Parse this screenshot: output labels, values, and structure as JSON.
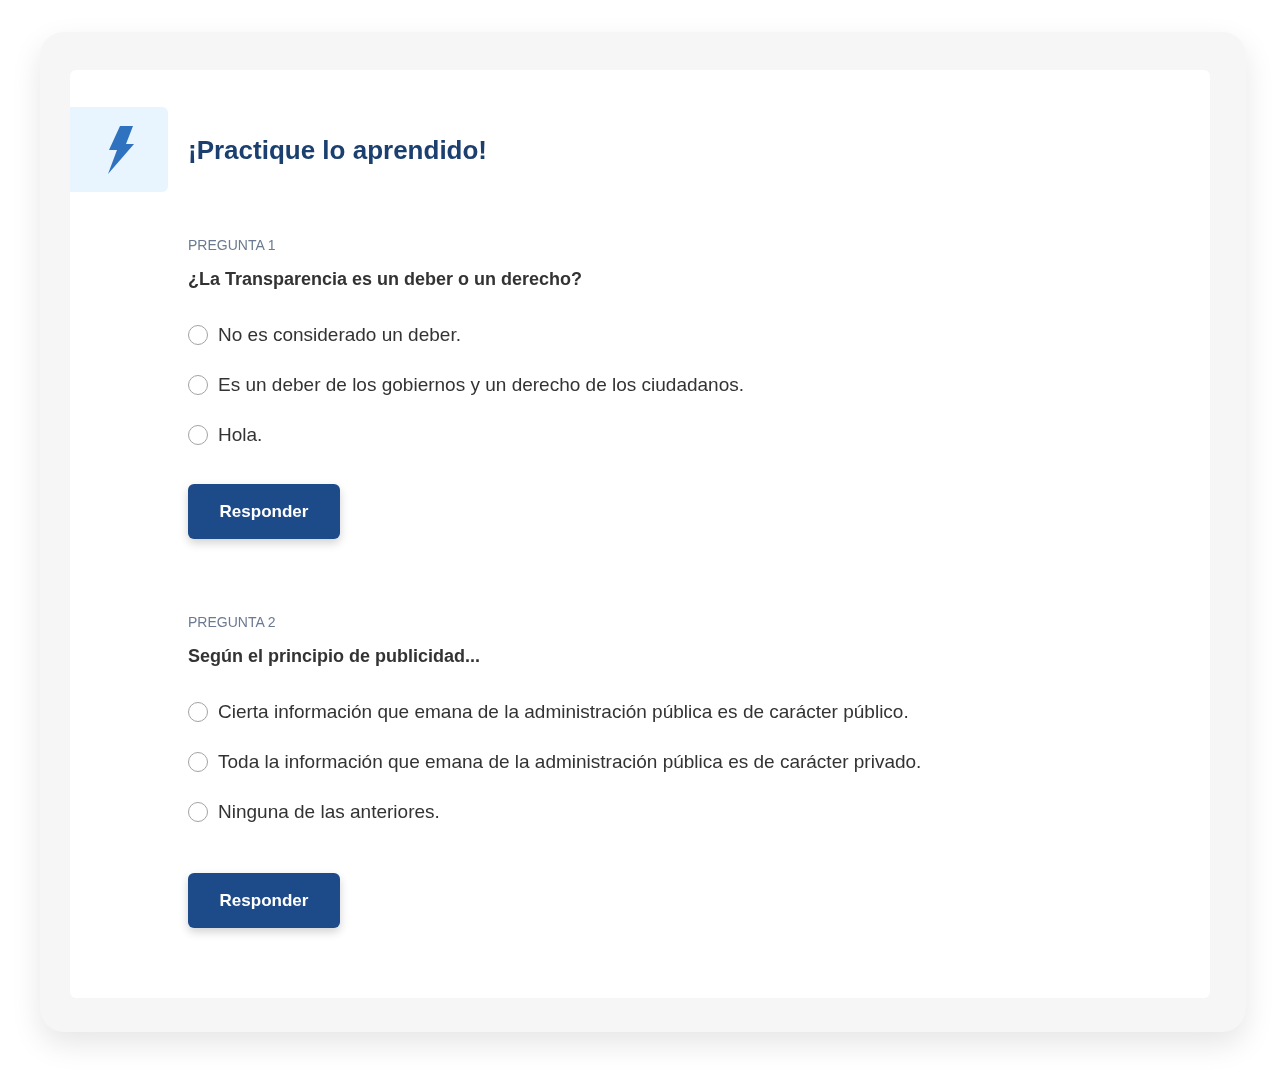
{
  "header": {
    "title": "¡Practique lo aprendido!"
  },
  "questions": [
    {
      "label": "PREGUNTA 1",
      "text": "¿La Transparencia es un deber o un derecho?",
      "options": [
        {
          "label": "No es considerado un deber.",
          "selected": false
        },
        {
          "label": "Es un deber de los gobiernos y un derecho de los ciudadanos.",
          "selected": false
        },
        {
          "label": "Hola.",
          "selected": false
        }
      ],
      "button": "Responder"
    },
    {
      "label": "PREGUNTA 2",
      "text": "Según el principio de publicidad...",
      "options": [
        {
          "label": "Cierta información que emana de la administración pública es de carácter público.",
          "selected": false
        },
        {
          "label": "Toda la información que emana de la administración pública es de carácter privado.",
          "selected": false
        },
        {
          "label": "Ninguna de las anteriores.",
          "selected": false
        }
      ],
      "button": "Responder"
    }
  ]
}
